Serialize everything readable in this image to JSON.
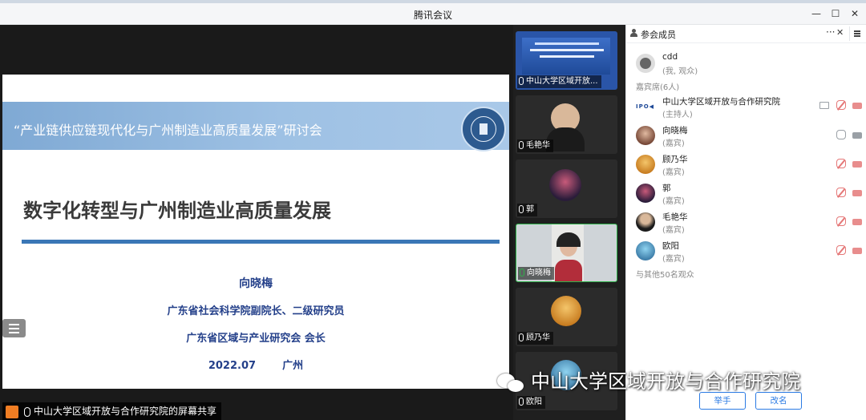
{
  "window": {
    "title": "腾讯会议",
    "minimize_glyph": "—",
    "maximize_glyph": "☐",
    "close_glyph": "✕"
  },
  "slide": {
    "header": "“产业链供应链现代化与广州制造业高质量发展”研讨会",
    "main_title": "数字化转型与广州制造业高质量发展",
    "speaker": "向晓梅",
    "position": "广东省社会科学院副院长、二级研究员",
    "org": "广东省区域与产业研究会  会长",
    "date": "2022.07",
    "place": "广州"
  },
  "share_bar": {
    "text": "中山大学区域开放与合作研究院的屏幕共享"
  },
  "tiles": [
    {
      "name": "中山大学区域开放..."
    },
    {
      "name": "毛艳华"
    },
    {
      "name": "郭"
    },
    {
      "name": "向晓梅"
    },
    {
      "name": "顾乃华"
    },
    {
      "name": "欧阳"
    }
  ],
  "panel": {
    "title": "参会成员",
    "more_glyph": "···",
    "close_glyph": "✕",
    "self": {
      "name": "cdd",
      "role": "(我, 观众)"
    },
    "guests_header": "嘉宾席(6人)",
    "guests": [
      {
        "name": "中山大学区域开放与合作研究院",
        "role": "(主持人)"
      },
      {
        "name": "向晓梅",
        "role": "(嘉宾)"
      },
      {
        "name": "顾乃华",
        "role": "(嘉宾)"
      },
      {
        "name": "郭",
        "role": "(嘉宾)"
      },
      {
        "name": "毛艳华",
        "role": "(嘉宾)"
      },
      {
        "name": "欧阳",
        "role": "(嘉宾)"
      }
    ],
    "others": "与其他50名观众",
    "raise_hand": "举手",
    "rename": "改名"
  },
  "watermark": "中山大学区域开放与合作研究院",
  "colors": {
    "accent_blue": "#2b7be4",
    "active_green": "#2fb14a",
    "muted_red": "#e57878",
    "slide_blue": "#24408a"
  }
}
